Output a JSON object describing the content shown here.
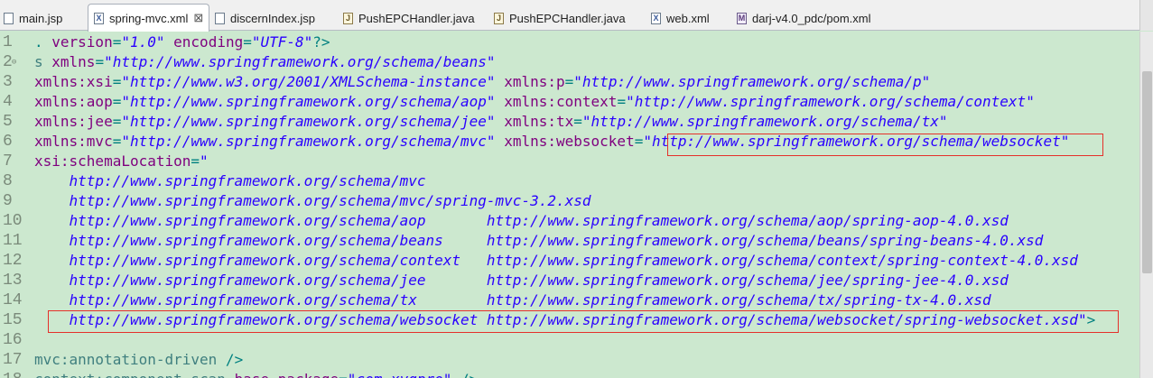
{
  "tabs": [
    {
      "label": "main.jsp",
      "icon": "jsp-file-icon",
      "active": false
    },
    {
      "label": "spring-mvc.xml",
      "icon": "xml-file-icon",
      "active": true,
      "close": "⊠"
    },
    {
      "label": "discernIndex.jsp",
      "icon": "jsp-file-icon",
      "active": false
    },
    {
      "label": "PushEPCHandler.java",
      "icon": "java-file-icon",
      "active": false
    },
    {
      "label": "PushEPCHandler.java",
      "icon": "java-file-icon",
      "active": false
    },
    {
      "label": "web.xml",
      "icon": "xml-file-icon",
      "active": false
    },
    {
      "label": "darj-v4.0_pdc/pom.xml",
      "icon": "pom-file-icon",
      "active": false
    }
  ],
  "lines": [
    {
      "n": "1",
      "fold": "",
      "segs": [
        [
          "p",
          ". "
        ],
        [
          "a",
          "version"
        ],
        [
          "p",
          "="
        ],
        [
          "s",
          "\"1.0\""
        ],
        [
          "p",
          " "
        ],
        [
          "a",
          "encoding"
        ],
        [
          "p",
          "="
        ],
        [
          "s",
          "\"UTF-8\""
        ],
        [
          "p",
          "?>"
        ]
      ]
    },
    {
      "n": "2",
      "fold": "⊖",
      "segs": [
        [
          "t",
          "s "
        ],
        [
          "a",
          "xmlns"
        ],
        [
          "p",
          "="
        ],
        [
          "s",
          "\"http://www.springframework.org/schema/beans\""
        ]
      ]
    },
    {
      "n": "3",
      "fold": "",
      "segs": [
        [
          "a",
          "xmlns:xsi"
        ],
        [
          "p",
          "="
        ],
        [
          "s",
          "\"http://www.w3.org/2001/XMLSchema-instance\""
        ],
        [
          "p",
          " "
        ],
        [
          "a",
          "xmlns:p"
        ],
        [
          "p",
          "="
        ],
        [
          "s",
          "\"http://www.springframework.org/schema/p\""
        ]
      ]
    },
    {
      "n": "4",
      "fold": "",
      "segs": [
        [
          "a",
          "xmlns:aop"
        ],
        [
          "p",
          "="
        ],
        [
          "s",
          "\"http://www.springframework.org/schema/aop\""
        ],
        [
          "p",
          " "
        ],
        [
          "a",
          "xmlns:context"
        ],
        [
          "p",
          "="
        ],
        [
          "s",
          "\"http://www.springframework.org/schema/context\""
        ]
      ]
    },
    {
      "n": "5",
      "fold": "",
      "segs": [
        [
          "a",
          "xmlns:jee"
        ],
        [
          "p",
          "="
        ],
        [
          "s",
          "\"http://www.springframework.org/schema/jee\""
        ],
        [
          "p",
          " "
        ],
        [
          "a",
          "xmlns:tx"
        ],
        [
          "p",
          "="
        ],
        [
          "s",
          "\"http://www.springframework.org/schema/tx\""
        ]
      ]
    },
    {
      "n": "6",
      "fold": "",
      "segs": [
        [
          "a",
          "xmlns:mvc"
        ],
        [
          "p",
          "="
        ],
        [
          "s",
          "\"http://www.springframework.org/schema/mvc\""
        ],
        [
          "p",
          " "
        ],
        [
          "a",
          "xmlns:websocket"
        ],
        [
          "p",
          "="
        ],
        [
          "s",
          "\"http://www.springframework.org/schema/websocket\""
        ]
      ]
    },
    {
      "n": "7",
      "fold": "",
      "segs": [
        [
          "a",
          "xsi:schemaLocation"
        ],
        [
          "p",
          "="
        ],
        [
          "s",
          "\""
        ]
      ]
    },
    {
      "n": "8",
      "fold": "",
      "segs": [
        [
          "s",
          "    http://www.springframework.org/schema/mvc"
        ]
      ]
    },
    {
      "n": "9",
      "fold": "",
      "segs": [
        [
          "s",
          "    http://www.springframework.org/schema/mvc/spring-mvc-3.2.xsd"
        ]
      ]
    },
    {
      "n": "10",
      "fold": "",
      "segs": [
        [
          "s",
          "    http://www.springframework.org/schema/aop       http://www.springframework.org/schema/aop/spring-aop-4.0.xsd"
        ]
      ]
    },
    {
      "n": "11",
      "fold": "",
      "segs": [
        [
          "s",
          "    http://www.springframework.org/schema/beans     http://www.springframework.org/schema/beans/spring-beans-4.0.xsd"
        ]
      ]
    },
    {
      "n": "12",
      "fold": "",
      "segs": [
        [
          "s",
          "    http://www.springframework.org/schema/context   http://www.springframework.org/schema/context/spring-context-4.0.xsd"
        ]
      ]
    },
    {
      "n": "13",
      "fold": "",
      "segs": [
        [
          "s",
          "    http://www.springframework.org/schema/jee       http://www.springframework.org/schema/jee/spring-jee-4.0.xsd"
        ]
      ]
    },
    {
      "n": "14",
      "fold": "",
      "segs": [
        [
          "s",
          "    http://www.springframework.org/schema/tx        http://www.springframework.org/schema/tx/spring-tx-4.0.xsd"
        ]
      ]
    },
    {
      "n": "15",
      "fold": "",
      "segs": [
        [
          "s",
          "    http://www.springframework.org/schema/websocket http://www.springframework.org/schema/websocket/spring-websocket.xsd\""
        ],
        [
          "p",
          ">"
        ]
      ]
    },
    {
      "n": "16",
      "fold": "",
      "segs": []
    },
    {
      "n": "17",
      "fold": "",
      "segs": [
        [
          "t",
          "mvc:annotation-driven"
        ],
        [
          "p",
          " />"
        ]
      ]
    },
    {
      "n": "18",
      "fold": "",
      "segs": [
        [
          "t",
          "context:component-scan"
        ],
        [
          "p",
          " "
        ],
        [
          "a",
          "base-package"
        ],
        [
          "p",
          "="
        ],
        [
          "s",
          "\"com.xygpro\""
        ],
        [
          "p",
          " />"
        ]
      ]
    }
  ],
  "colors": {
    "editor_bg": "#cce8cf",
    "highlight_border": "#e5302a"
  }
}
